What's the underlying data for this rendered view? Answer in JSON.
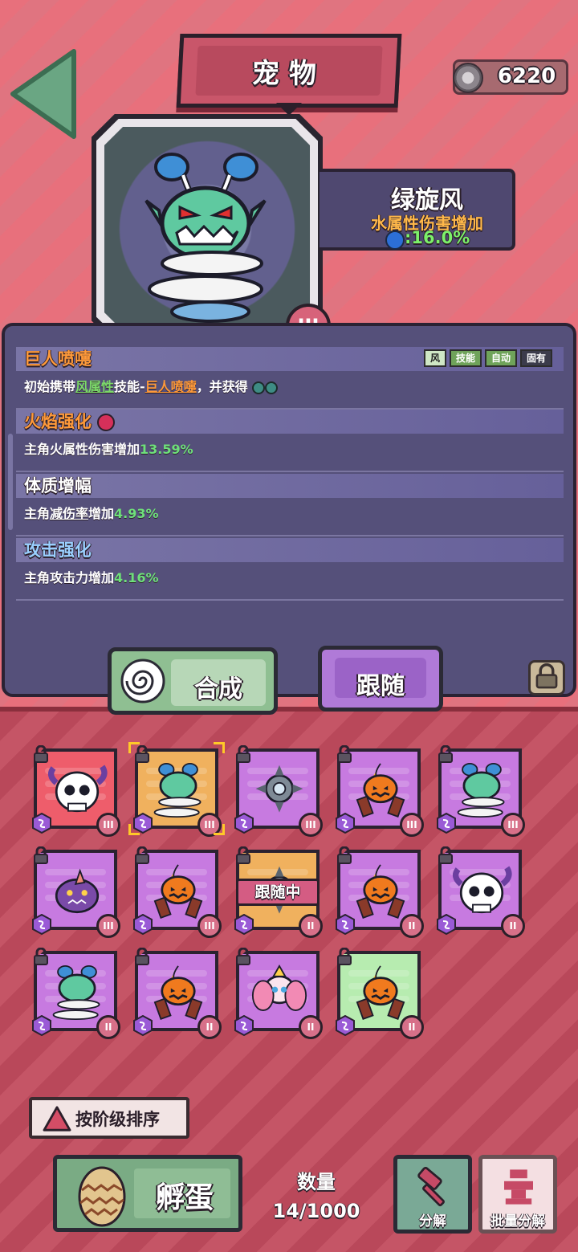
{
  "header": {
    "title": "宠物",
    "currency_value": "6220"
  },
  "pet": {
    "name": "绿旋风",
    "attribute": "水属性伤害增加",
    "attribute_value": ":16.0%",
    "tier": "III"
  },
  "skills": [
    {
      "name": "巨人喷嚏",
      "name_color": "#ff9a3a",
      "tags": [
        "风",
        "技能",
        "自动",
        "固有"
      ],
      "desc_parts": [
        "初始携带",
        "风属性",
        "技能-",
        "巨人喷嚏",
        "，并获得"
      ]
    },
    {
      "name": "火焰强化",
      "name_color": "#ff9a3a",
      "desc": "主角火属性伤害增加",
      "value": "13.59%"
    },
    {
      "name": "体质增幅",
      "name_color": "#ffffff",
      "desc_a": "主角",
      "desc_b": "减伤率",
      "desc_c": "增加",
      "value": "4.93%"
    },
    {
      "name": "攻击强化",
      "name_color": "#9ad0ff",
      "desc": "主角攻击力增加",
      "value": "4.16%"
    }
  ],
  "actions": {
    "compose": "合成",
    "follow": "跟随"
  },
  "grid": {
    "following_label": "跟随中",
    "cards": [
      {
        "pet": "skull-ghost",
        "bg": "red",
        "tier": "III"
      },
      {
        "pet": "green-tornado",
        "bg": "orange",
        "tier": "III",
        "selected": true
      },
      {
        "pet": "spike-drone",
        "bg": "purple",
        "tier": "III"
      },
      {
        "pet": "pumpkin-flame",
        "bg": "purple",
        "tier": "III"
      },
      {
        "pet": "green-tornado",
        "bg": "purple",
        "tier": "III"
      },
      {
        "pet": "purple-horn-blob",
        "bg": "purple",
        "tier": "III"
      },
      {
        "pet": "pumpkin-flame",
        "bg": "purple",
        "tier": "III"
      },
      {
        "pet": "spike-drone",
        "bg": "orange",
        "tier": "II",
        "following": true
      },
      {
        "pet": "pumpkin-flame",
        "bg": "purple",
        "tier": "II"
      },
      {
        "pet": "skull-ghost",
        "bg": "purple",
        "tier": "II"
      },
      {
        "pet": "green-tornado",
        "bg": "purple",
        "tier": "II"
      },
      {
        "pet": "pumpkin-flame",
        "bg": "purple",
        "tier": "II"
      },
      {
        "pet": "pink-fairy",
        "bg": "purple",
        "tier": "II"
      },
      {
        "pet": "pumpkin-flame",
        "bg": "green",
        "tier": "II"
      }
    ]
  },
  "footer": {
    "sort_label": "按阶级排序",
    "hatch_label": "孵蛋",
    "quantity_label": "数量",
    "quantity_value": "14/1000",
    "decompose_label": "分解",
    "batch_decompose_label": "批量分解"
  }
}
